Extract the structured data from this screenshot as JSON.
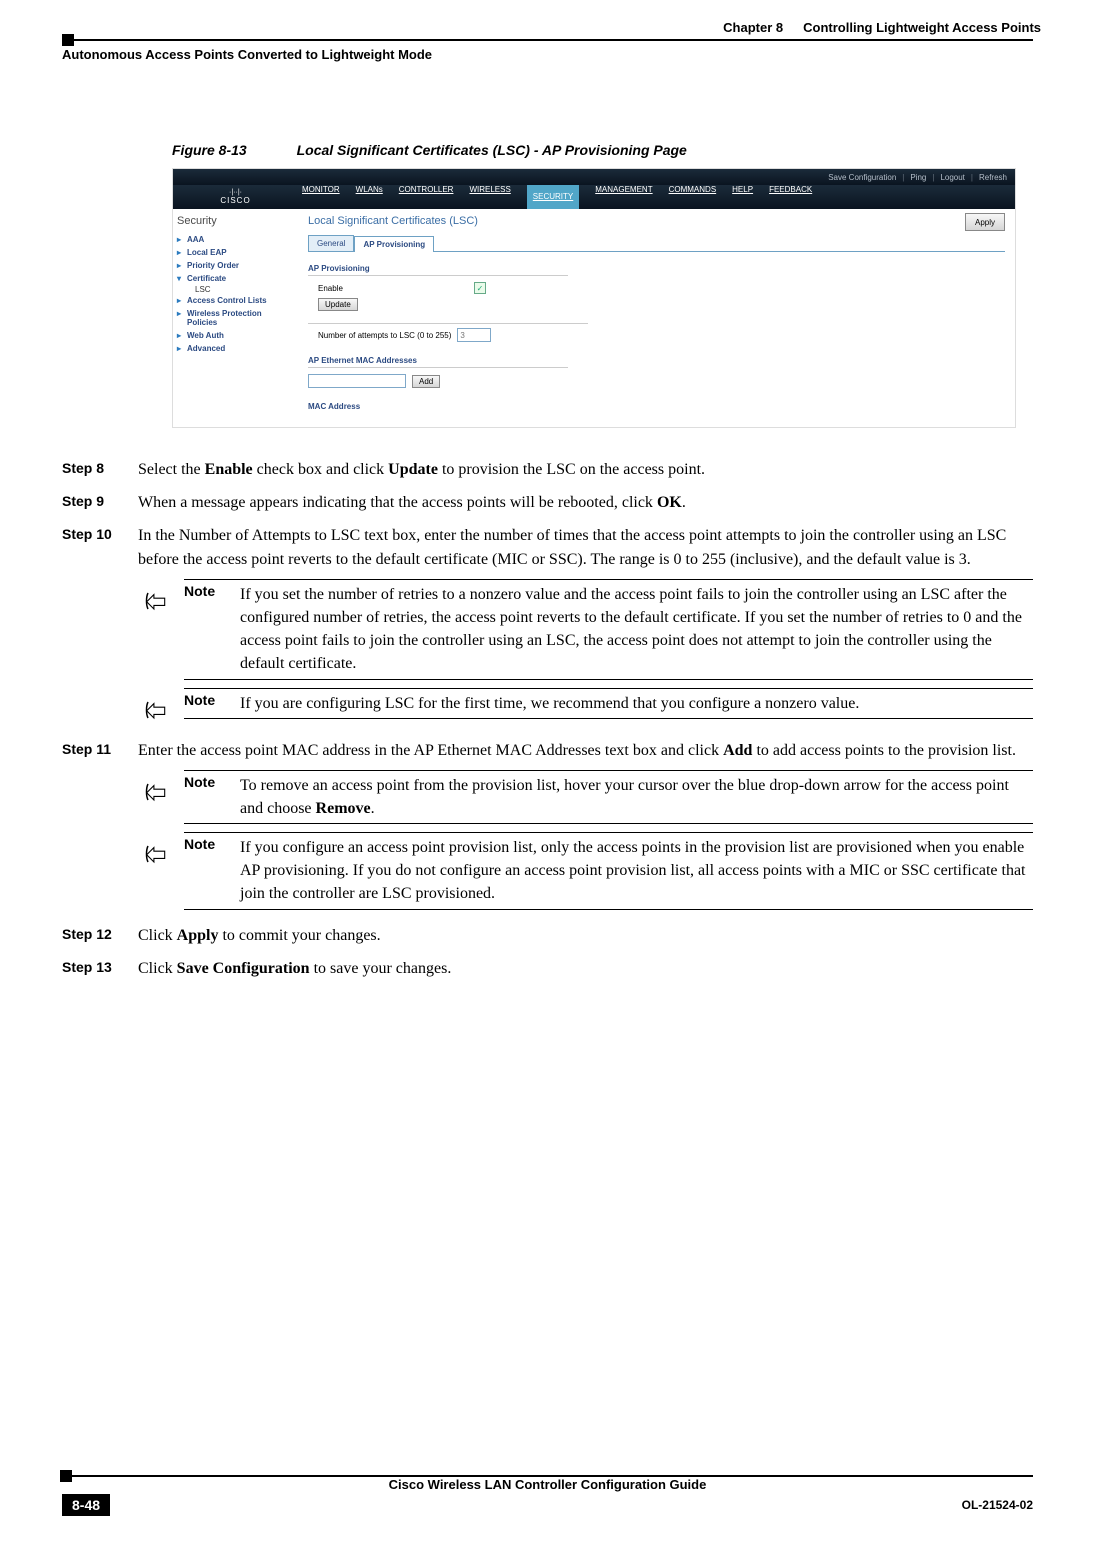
{
  "header": {
    "chapter": "Chapter 8",
    "chapter_title": "Controlling Lightweight Access Points",
    "section_title": "Autonomous Access Points Converted to Lightweight Mode"
  },
  "figure": {
    "label": "Figure 8-13",
    "title": "Local Significant Certificates (LSC) - AP Provisioning Page",
    "image_ref": "251998"
  },
  "screenshot": {
    "top_links": [
      "Save Configuration",
      "Ping",
      "Logout",
      "Refresh"
    ],
    "logo_brand": "CISCO",
    "menu": [
      "MONITOR",
      "WLANs",
      "CONTROLLER",
      "WIRELESS",
      "SECURITY",
      "MANAGEMENT",
      "COMMANDS",
      "HELP",
      "FEEDBACK"
    ],
    "active_menu": "SECURITY",
    "sidebar": {
      "title": "Security",
      "items": [
        "AAA",
        "Local EAP",
        "Priority Order",
        "Certificate",
        "Access Control Lists",
        "Wireless Protection Policies",
        "Web Auth",
        "Advanced"
      ],
      "open_item": "Certificate",
      "sub_items": [
        "LSC"
      ]
    },
    "main": {
      "title": "Local Significant Certificates (LSC)",
      "apply": "Apply",
      "tabs": [
        "General",
        "AP Provisioning"
      ],
      "active_tab": "AP Provisioning",
      "fs1_title": "AP Provisioning",
      "enable_label": "Enable",
      "enable_checked": true,
      "update_btn": "Update",
      "attempts_label": "Number of attempts to LSC (0 to 255)",
      "attempts_value": "3",
      "fs2_title": "AP Ethernet MAC Addresses",
      "mac_value": "",
      "add_btn": "Add",
      "fs3_title": "MAC Address"
    }
  },
  "steps": {
    "s8_label": "Step 8",
    "s8_pre": "Select the ",
    "s8_b1": "Enable",
    "s8_mid1": " check box and click ",
    "s8_b2": "Update",
    "s8_post": " to provision the LSC on the access point.",
    "s9_label": "Step 9",
    "s9_pre": "When a message appears indicating that the access points will be rebooted, click ",
    "s9_b1": "OK",
    "s9_post": ".",
    "s10_label": "Step 10",
    "s10_text": "In the Number of Attempts to LSC text box, enter the number of times that the access point attempts to join the controller using an LSC before the access point reverts to the default certificate (MIC or SSC). The range is 0 to 255 (inclusive), and the default value is 3.",
    "s10_note1": "If you set the number of retries to a nonzero value and the access point fails to join the controller using an LSC after the configured number of retries, the access point reverts to the default certificate. If you set the number of retries to 0 and the access point fails to join the controller using an LSC, the access point does not attempt to join the controller using the default certificate.",
    "s10_note2": "If you are configuring LSC for the first time, we recommend that you configure a nonzero value.",
    "s11_label": "Step 11",
    "s11_pre": "Enter the access point MAC address in the AP Ethernet MAC Addresses text box and click ",
    "s11_b1": "Add",
    "s11_post": " to add access points to the provision list.",
    "s11_note1_pre": "To remove an access point from the provision list, hover your cursor over the blue drop-down arrow for the access point and choose ",
    "s11_note1_b": "Remove",
    "s11_note1_post": ".",
    "s11_note2": "If you configure an access point provision list, only the access points in the provision list are provisioned when you enable AP provisioning. If you do not configure an access point provision list, all access points with a MIC or SSC certificate that join the controller are LSC provisioned.",
    "s12_label": "Step 12",
    "s12_pre": "Click ",
    "s12_b1": "Apply",
    "s12_post": " to commit your changes.",
    "s13_label": "Step 13",
    "s13_pre": "Click ",
    "s13_b1": "Save Configuration",
    "s13_post": " to save your changes."
  },
  "note_label": "Note",
  "footer": {
    "guide": "Cisco Wireless LAN Controller Configuration Guide",
    "page": "8-48",
    "docnum": "OL-21524-02"
  }
}
